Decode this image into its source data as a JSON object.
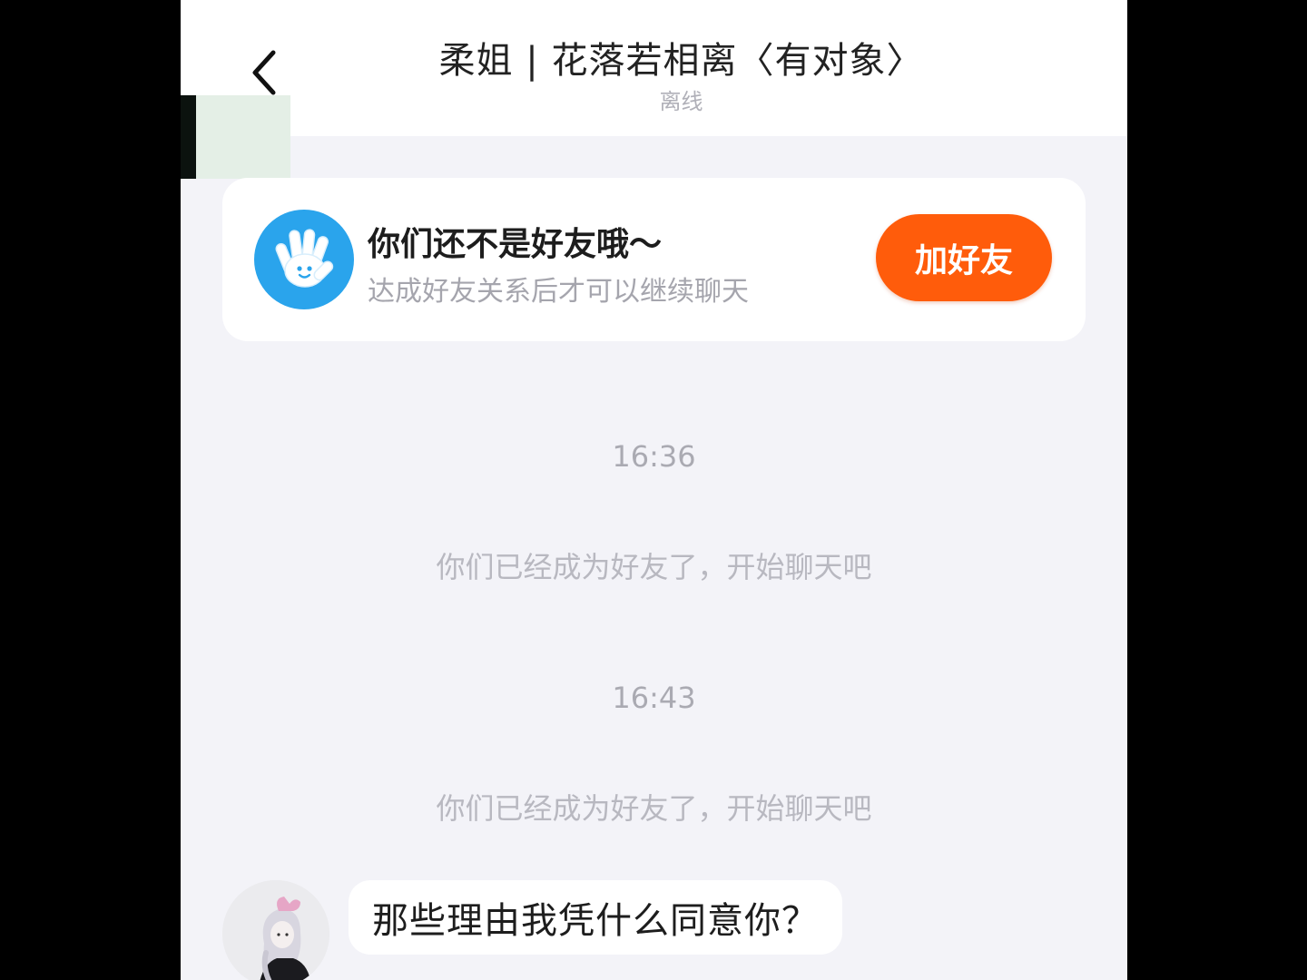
{
  "header": {
    "title": "柔姐 | 花落若相离〈有对象〉",
    "status": "离线",
    "back_icon": "chevron-left-icon"
  },
  "friend_notice": {
    "icon": "waving-hand-icon",
    "title": "你们还不是好友哦～",
    "subtitle": "达成好友关系后才可以继续聊天",
    "button_label": "加好友",
    "button_color": "#ff5c0b"
  },
  "messages": [
    {
      "type": "time",
      "text": "16:36"
    },
    {
      "type": "system",
      "text": "你们已经成为好友了，开始聊天吧"
    },
    {
      "type": "time",
      "text": "16:43"
    },
    {
      "type": "system",
      "text": "你们已经成为好友了，开始聊天吧"
    },
    {
      "type": "incoming",
      "avatar": "anime-girl-avatar",
      "text": "那些理由我凭什么同意你？"
    }
  ],
  "colors": {
    "background": "#f3f3f8",
    "accent": "#ff5c0b",
    "icon_blue": "#2aa4ec"
  }
}
